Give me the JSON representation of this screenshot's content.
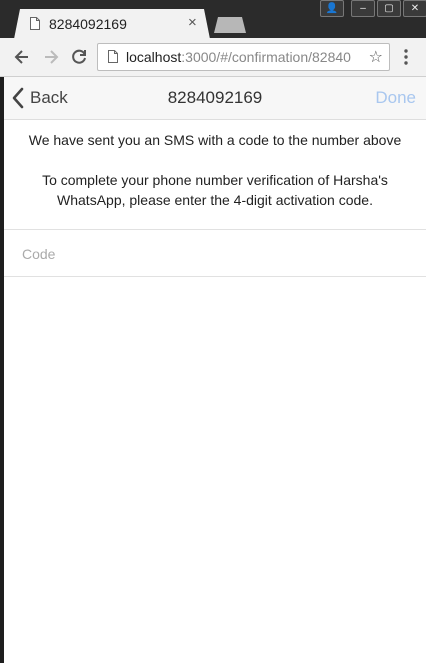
{
  "tab": {
    "title": "8284092169",
    "close": "×"
  },
  "window_controls": {
    "user": "👤",
    "minimize": "–",
    "maximize": "▢",
    "close": "✕"
  },
  "address_bar": {
    "host": "localhost",
    "path": ":3000/#/confirmation/82840",
    "star": "☆"
  },
  "app_bar": {
    "back_label": "Back",
    "title": "8284092169",
    "done_label": "Done"
  },
  "content": {
    "sms_notice": "We have sent you an SMS with a code to the number above",
    "instructions": "To complete your phone number verification of Harsha's WhatsApp, please enter the 4-digit activation code.",
    "code_placeholder": "Code"
  },
  "colors": {
    "done_disabled": "#a9c7ef",
    "titlebar": "#2b2b2b"
  },
  "icons": [
    "page-icon",
    "back-arrow-icon",
    "forward-arrow-icon",
    "reload-icon",
    "star-icon",
    "menu-icon",
    "chevron-left-icon"
  ]
}
